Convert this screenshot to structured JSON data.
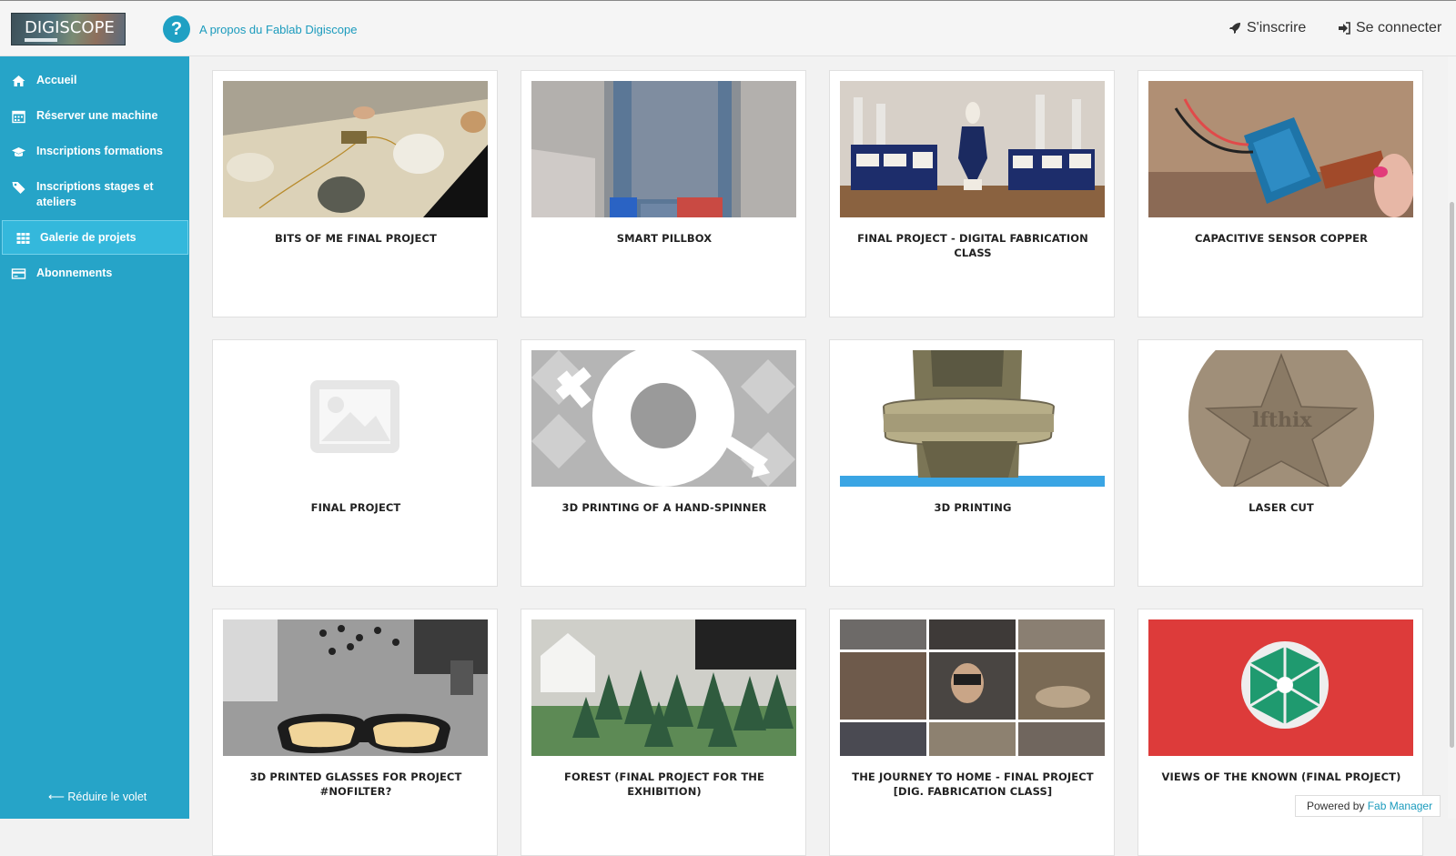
{
  "header": {
    "logo_text": "DIGISCOPE",
    "about_link": "A propos du Fablab Digiscope",
    "signup": "S'inscrire",
    "login": "Se connecter"
  },
  "sidebar": {
    "items": [
      {
        "label": "Accueil",
        "icon": "home-icon"
      },
      {
        "label": "Réserver une machine",
        "icon": "calendar-icon"
      },
      {
        "label": "Inscriptions formations",
        "icon": "graduation-cap-icon"
      },
      {
        "label": "Inscriptions stages et ateliers",
        "icon": "tags-icon"
      },
      {
        "label": "Galerie de projets",
        "icon": "grid-icon",
        "active": true
      },
      {
        "label": "Abonnements",
        "icon": "credit-card-icon"
      }
    ],
    "collapse_label": "Réduire le volet"
  },
  "projects": [
    {
      "title": "BITS OF ME FINAL PROJECT"
    },
    {
      "title": "SMART PILLBOX"
    },
    {
      "title": "FINAL PROJECT - DIGITAL FABRICATION CLASS"
    },
    {
      "title": "CAPACITIVE SENSOR COPPER"
    },
    {
      "title": "FINAL PROJECT"
    },
    {
      "title": "3D PRINTING OF A HAND-SPINNER"
    },
    {
      "title": "3D PRINTING"
    },
    {
      "title": "LASER CUT"
    },
    {
      "title": "3D PRINTED GLASSES FOR PROJECT #NOFILTER?"
    },
    {
      "title": "FOREST (FINAL PROJECT FOR THE EXHIBITION)"
    },
    {
      "title": "THE JOURNEY TO HOME - FINAL PROJECT [DIG. FABRICATION CLASS]"
    },
    {
      "title": "VIEWS OF THE KNOWN (FINAL PROJECT)"
    }
  ],
  "footer": {
    "powered_prefix": "Powered by",
    "powered_link": "Fab Manager"
  },
  "colors": {
    "sidebar": "#26a4c8",
    "accent": "#1b9bbd"
  }
}
